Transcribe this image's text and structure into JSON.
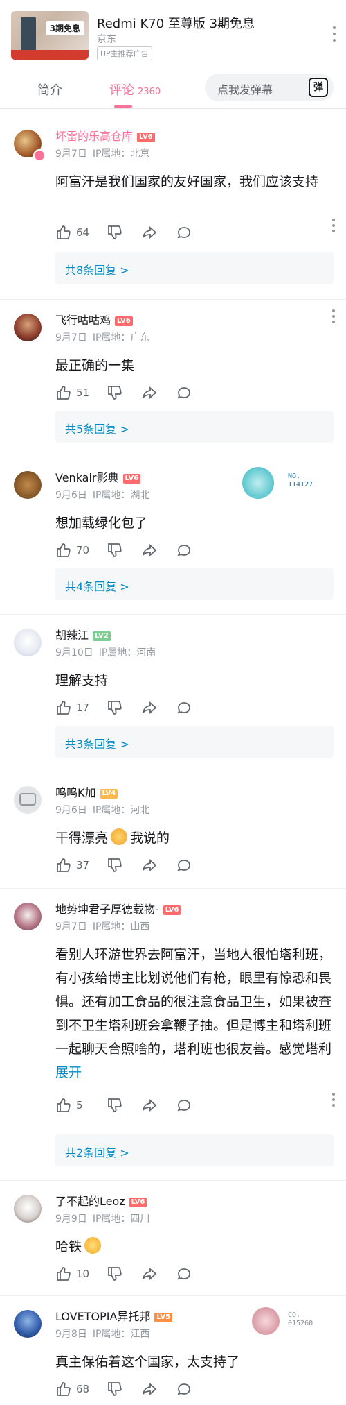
{
  "ad": {
    "title": "Redmi K70 至尊版 3期免息",
    "merchant": "京东",
    "badge": "UP主推荐广告",
    "thumb_text": "3期免息"
  },
  "tabs": {
    "intro": "简介",
    "comments": "评论",
    "comment_count": "2360",
    "danmaku_placeholder": "点我发弹幕",
    "danmaku_btn": "弹"
  },
  "colors": {
    "accent": "#fb7299",
    "link": "#008ac5",
    "lv6": "#ff6a6a",
    "lv5": "#ff8f43",
    "lv4": "#ffb84d",
    "lv2": "#7bcd90"
  },
  "comments": [
    {
      "user": "坏雷的乐高仓库",
      "level": "LV6",
      "date": "9月7日",
      "ip": "IP属地：北京",
      "text": "阿富汗是我们国家的友好国家，我们应该支持",
      "likes": "64",
      "replies": "共8条回复 >"
    },
    {
      "user": "飞行咕咕鸡",
      "level": "LV6",
      "date": "9月7日",
      "ip": "IP属地：广东",
      "text": "最正确的一集",
      "likes": "51",
      "replies": "共5条回复 >"
    },
    {
      "user": "Venkair影典",
      "level": "LV6",
      "date": "9月6日",
      "ip": "IP属地：湖北",
      "text": "想加载绿化包了",
      "likes": "70",
      "replies": "共4条回复 >",
      "badge_no": "NO.\n114127"
    },
    {
      "user": "胡辣江",
      "level": "LV2",
      "date": "9月10日",
      "ip": "IP属地：河南",
      "text": "理解支持",
      "likes": "17",
      "replies": "共3条回复 >"
    },
    {
      "user": "呜呜K加",
      "level": "LV4",
      "date": "9月6日",
      "ip": "IP属地：河北",
      "text_a": "干得漂亮",
      "text_b": "我说的",
      "likes": "37"
    },
    {
      "user": "地势坤君子厚德载物-",
      "level": "LV6",
      "date": "9月7日",
      "ip": "IP属地：山西",
      "text": "看别人环游世界去阿富汗，当地人很怕塔利班，有小孩给博主比划说他们有枪，眼里有惊恐和畏惧。还有加工食品的很注意食品卫生，如果被查到不卫生塔利班会拿鞭子抽。但是博主和塔利班一起聊天合照啥的，塔利班也很友善。感觉塔利班是不是还没有获得",
      "expand": "展开",
      "likes": "5",
      "replies": "共2条回复 >"
    },
    {
      "user": "了不起的Leoz",
      "level": "LV6",
      "date": "9月9日",
      "ip": "IP属地：四川",
      "text": "哈铁",
      "likes": "10"
    },
    {
      "user": "LOVETOPIA异托邦",
      "level": "LV5",
      "date": "9月8日",
      "ip": "IP属地：江西",
      "text": "真主保佑着这个国家，太支持了",
      "likes": "68",
      "badge_no": "CO.\n015260"
    }
  ]
}
